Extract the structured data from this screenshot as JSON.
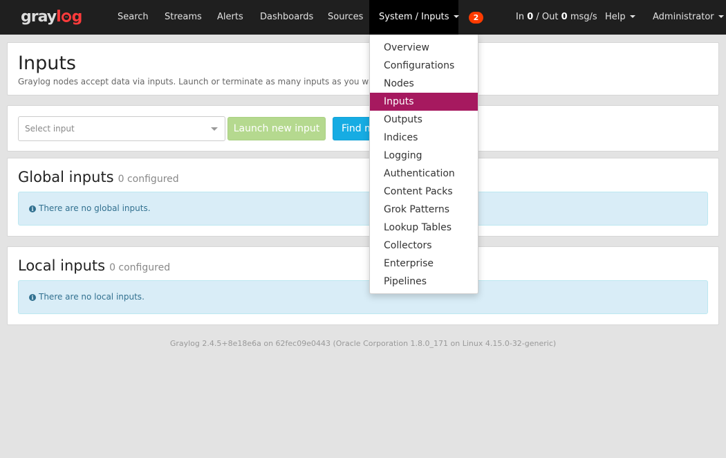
{
  "navbar": {
    "brand_part1": "gray",
    "brand_part2": "g",
    "items": [
      {
        "label": "Search"
      },
      {
        "label": "Streams"
      },
      {
        "label": "Alerts"
      },
      {
        "label": "Dashboards"
      },
      {
        "label": "Sources"
      }
    ],
    "system_label": "System / Inputs",
    "notification_count": "2",
    "throughput": {
      "in_label": "In",
      "in_value": "0",
      "sep": "/ Out",
      "out_value": "0",
      "unit": "msg/s"
    },
    "help_label": "Help",
    "user_label": "Administrator"
  },
  "header": {
    "title": "Inputs",
    "description": "Graylog nodes accept data via inputs. Launch or terminate as many inputs as you want here."
  },
  "toolbar": {
    "select_placeholder": "Select input",
    "launch_label": "Launch new input",
    "find_label": "Find more inputs"
  },
  "global_inputs": {
    "title": "Global inputs",
    "count": "0 configured",
    "empty_message": "There are no global inputs."
  },
  "local_inputs": {
    "title": "Local inputs",
    "count": "0 configured",
    "empty_message": "There are no local inputs."
  },
  "footer": {
    "text": "Graylog 2.4.5+8e18e6a on 62fec09e0443 (Oracle Corporation 1.8.0_171 on Linux 4.15.0-32-generic)"
  },
  "system_menu": {
    "items": [
      {
        "label": "Overview"
      },
      {
        "label": "Configurations"
      },
      {
        "label": "Nodes"
      },
      {
        "label": "Inputs"
      },
      {
        "label": "Outputs"
      },
      {
        "label": "Indices"
      },
      {
        "label": "Logging"
      },
      {
        "label": "Authentication"
      },
      {
        "label": "Content Packs"
      },
      {
        "label": "Grok Patterns"
      },
      {
        "label": "Lookup Tables"
      },
      {
        "label": "Collectors"
      },
      {
        "label": "Enterprise"
      },
      {
        "label": "Pipelines"
      }
    ],
    "active_label": "Inputs"
  },
  "colors": {
    "navbar_bg": "#1f1f1f",
    "active_menu": "#a6195f",
    "launch_button": "#b5d98f",
    "find_button": "#16ace3",
    "badge": "#ff3b00",
    "info_bg": "#d9edf7"
  },
  "icons": {
    "info": "info-circle-icon",
    "caret": "caret-down-icon"
  }
}
